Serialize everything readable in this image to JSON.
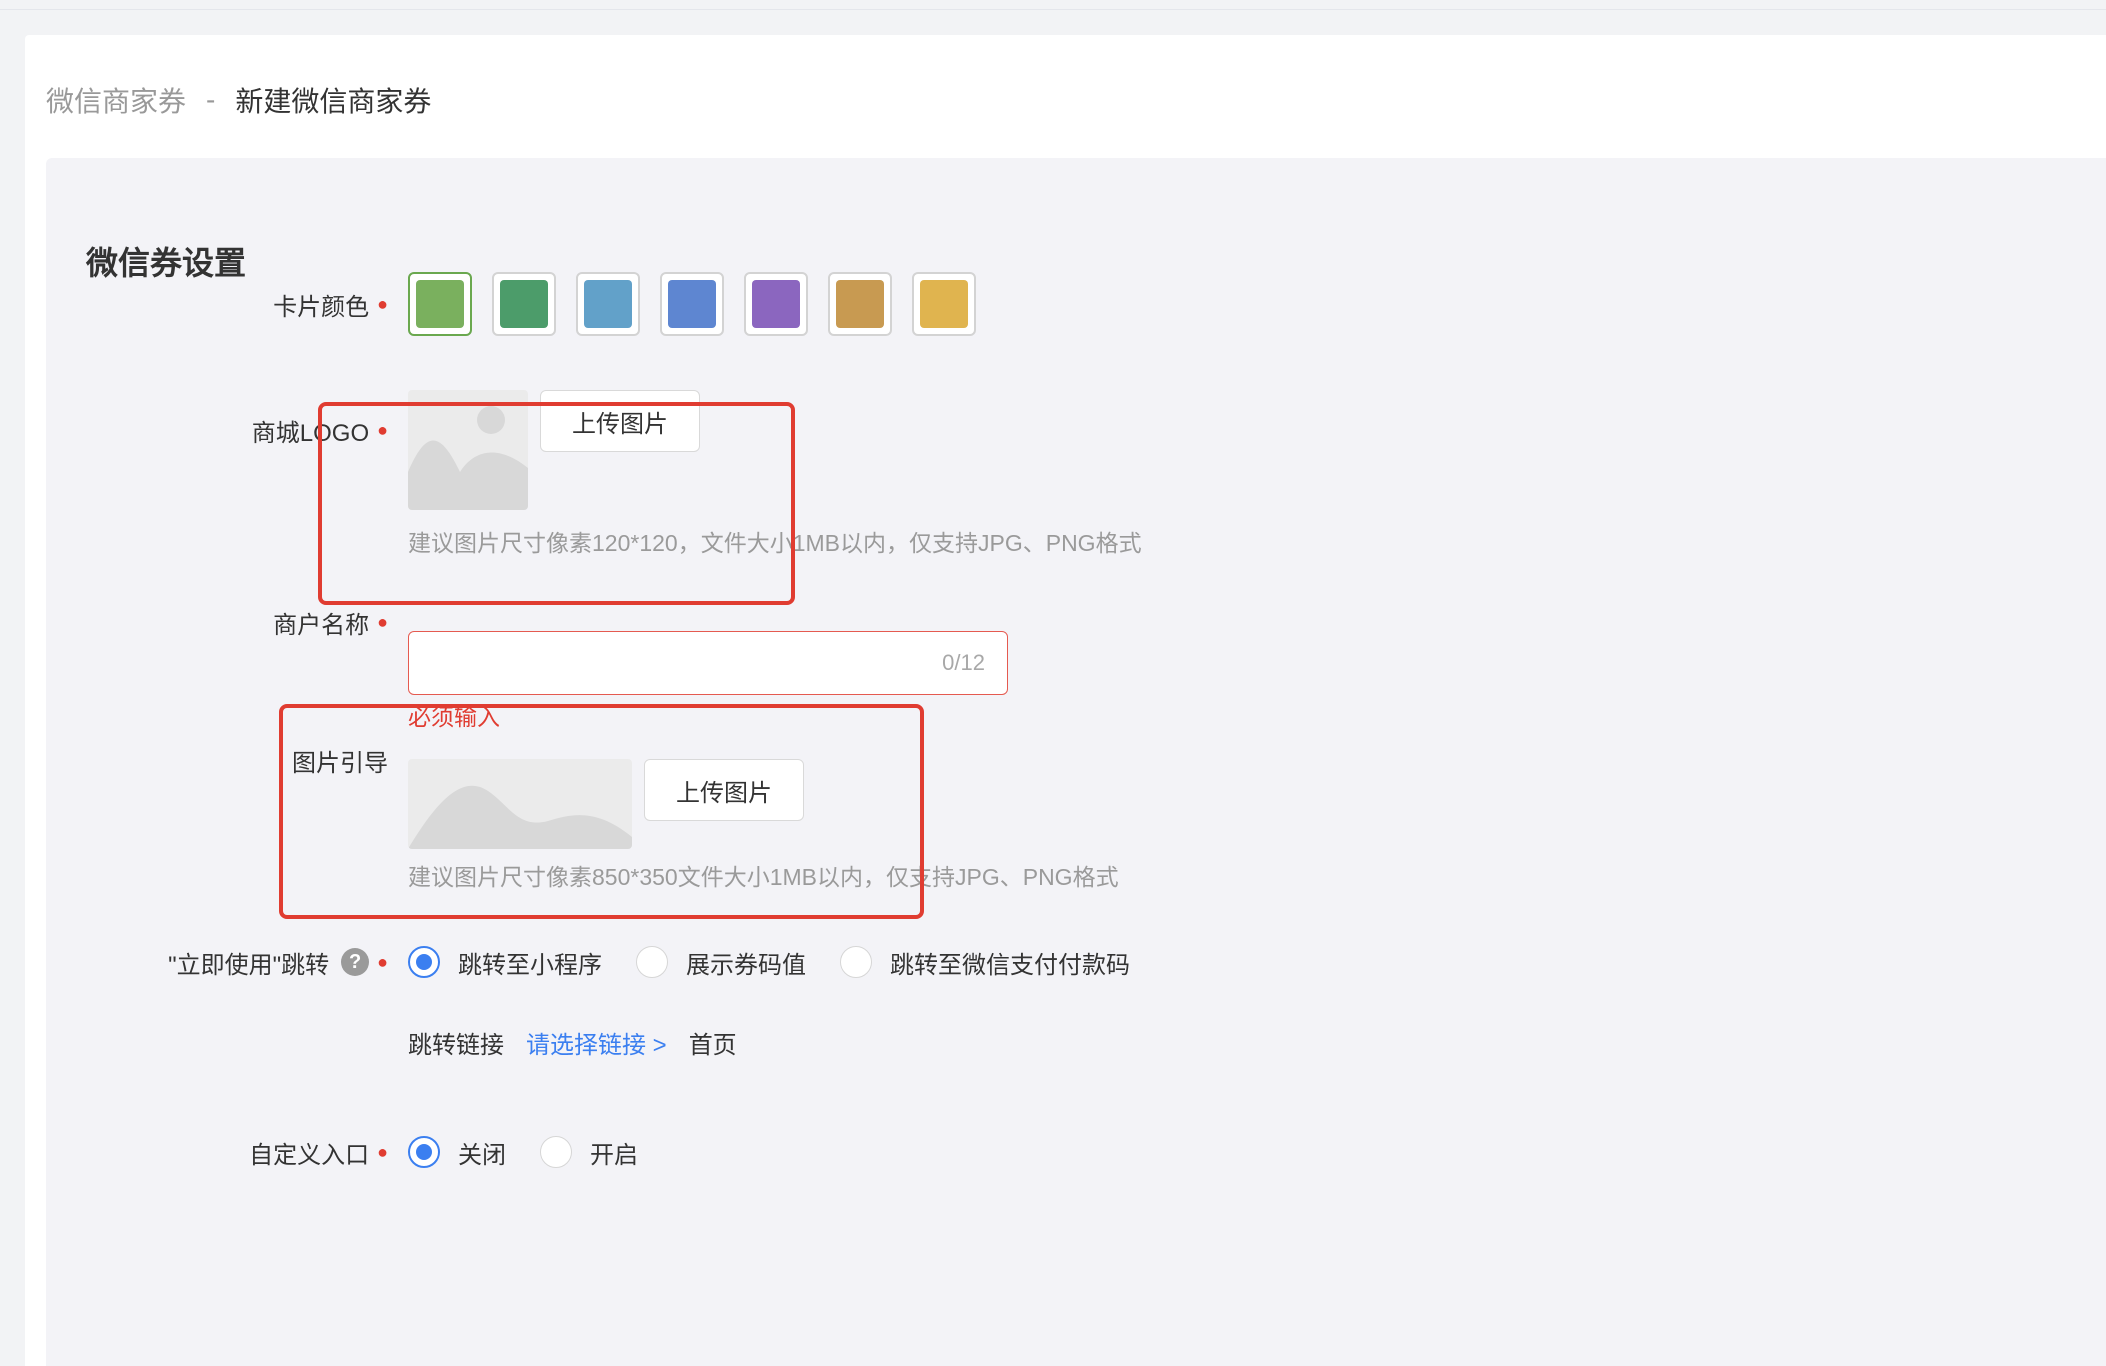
{
  "breadcrumb": {
    "parent": "微信商家券",
    "separator": "-",
    "current": "新建微信商家券"
  },
  "section": {
    "title": "微信券设置"
  },
  "form": {
    "card_color": {
      "label": "卡片颜色",
      "required": true,
      "selected_index": 0,
      "swatches": [
        "#7ab05e",
        "#4c9c6a",
        "#62a1c9",
        "#5e86d1",
        "#8b66bf",
        "#c89a51",
        "#e0b44f"
      ]
    },
    "logo": {
      "label": "商城LOGO",
      "required": true,
      "upload_label": "上传图片",
      "hint": "建议图片尺寸像素120*120，文件大小1MB以内，仅支持JPG、PNG格式"
    },
    "merchant_name": {
      "label": "商户名称",
      "required": true,
      "value": "",
      "placeholder": "",
      "counter": "0/12",
      "error": "必须输入"
    },
    "image_guide": {
      "label": "图片引导",
      "required": false,
      "upload_label": "上传图片",
      "hint": "建议图片尺寸像素850*350文件大小1MB以内，仅支持JPG、PNG格式"
    },
    "use_now_jump": {
      "label": "\"立即使用\"跳转",
      "help": "?",
      "required": true,
      "options": [
        "跳转至小程序",
        "展示券码值",
        "跳转至微信支付付款码"
      ],
      "selected_index": 0
    },
    "jump_link": {
      "label": "跳转链接",
      "select_text": "请选择链接 >",
      "value": "首页"
    },
    "custom_entry": {
      "label": "自定义入口",
      "required": true,
      "options": [
        "关闭",
        "开启"
      ],
      "selected_index": 0
    }
  },
  "colors": {
    "accent": "#3b7ff0",
    "error": "#e03c31",
    "annotation": "#e03c31"
  }
}
